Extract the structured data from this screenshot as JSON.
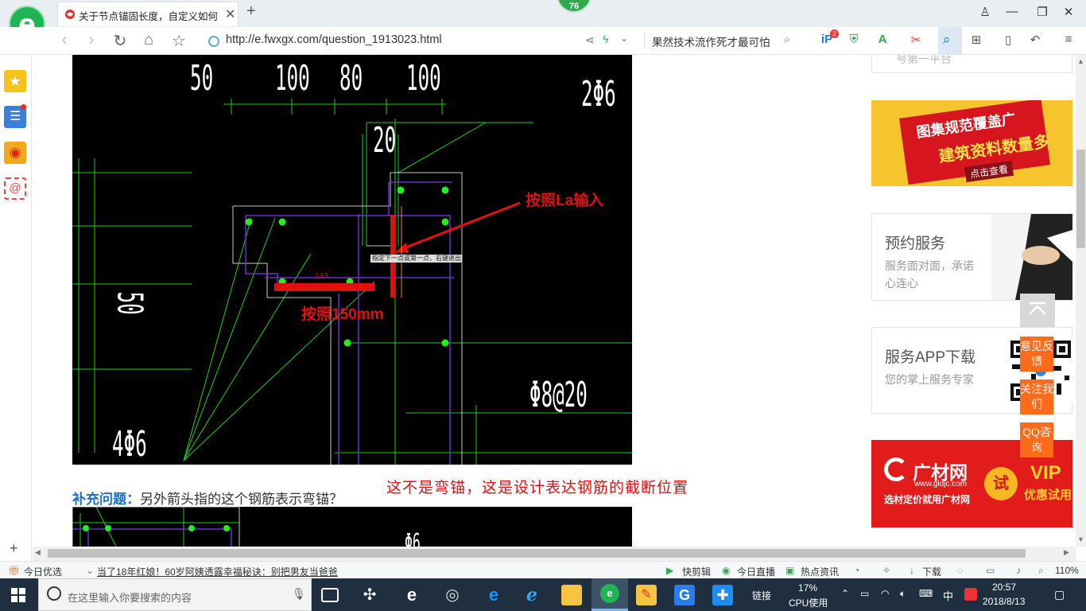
{
  "browser": {
    "tab_title": "关于节点锚固长度，自定义如何设",
    "badge_count": "76",
    "url": "http://e.fwxgx.com/question_1913023.html",
    "search_hint": "果然技术流作死才最可怕",
    "ip_badge": "2"
  },
  "cad": {
    "dim_labels": [
      "50",
      "100",
      "80",
      "100",
      "2Φ6",
      "20",
      "50",
      "Φ8@20",
      "4Φ6",
      "143"
    ],
    "tooltip": "指定下一点或第一点，右键退出",
    "anno_la": "按照La输入",
    "anno_150": "按照150mm"
  },
  "question": {
    "label": "补充问题：",
    "text": "另外箭头指的这个钢筋表示弯锚？",
    "answer": "这不是弯锚，这是设计表达钢筋的截断位置",
    "cad2_label": "Φ6"
  },
  "ads": {
    "top_partial": "号第一平台",
    "banner1_line1": "图集规范覆盖广",
    "banner1_line2": "建筑资料数量多",
    "banner1_btn": "点击查看",
    "card1_title": "预约服务",
    "card1_sub": "服务面对面，承诺心连心",
    "card2_title": "服务APP下载",
    "card2_sub": "您的掌上服务专家",
    "banner2_brand": "广材网",
    "banner2_url": "www.gldjc.com",
    "banner2_slogan": "选材定价就用广材网",
    "banner2_try": "试",
    "banner2_vip": "VIP",
    "banner2_vip_sub": "优惠试用"
  },
  "float_buttons": [
    "意见反馈",
    "关注我们",
    "QQ咨询"
  ],
  "status_bar": {
    "left": "今日优选",
    "news": "当了18年红娘！60岁阿姨透露幸福秘诀：别把男友当爸爸",
    "kuaijian": "快剪辑",
    "zhibo": "今日直播",
    "redian": "热点资讯",
    "download": "下载",
    "zoom": "110%"
  },
  "taskbar": {
    "search_placeholder": "在这里输入你要搜索的内容",
    "link": "链接",
    "cpu_pct": "17%",
    "cpu_label": "CPU使用",
    "ime": "中",
    "time": "20:57",
    "date": "2018/8/13"
  },
  "colors": {
    "cad_bg": "#000000",
    "cad_green": "#22dd22",
    "cad_purple": "#6a2fd0",
    "anno_red": "#e01010",
    "accent_orange": "#ff6b18",
    "banner_red": "#d7151f"
  }
}
